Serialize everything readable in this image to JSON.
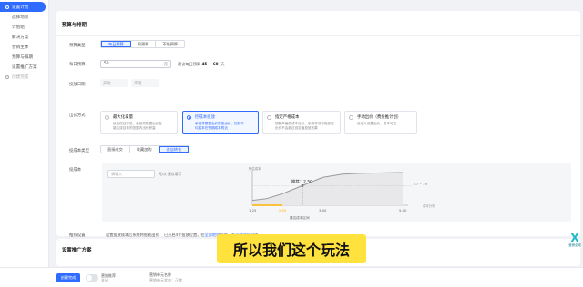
{
  "sidebar": {
    "items": [
      {
        "label": "设置计划",
        "state": "active"
      },
      {
        "label": "选择场景",
        "state": "normal"
      },
      {
        "label": "计划组",
        "state": "normal"
      },
      {
        "label": "解决方案",
        "state": "normal"
      },
      {
        "label": "营销主体",
        "state": "normal"
      },
      {
        "label": "预算与排期",
        "state": "normal"
      },
      {
        "label": "设置推广方案",
        "state": "normal"
      },
      {
        "label": "创建完成",
        "state": "muted"
      }
    ]
  },
  "budget_section": {
    "title": "预算与排期",
    "budget_type": {
      "label": "预算类型",
      "options": [
        "每日预算",
        "周预算",
        "不限预算"
      ],
      "selected": "每日预算"
    },
    "daily_budget": {
      "label": "每日预算",
      "value": "50",
      "unit": "元",
      "hint_prefix": "建议每日预算",
      "hint_range": "45 ~ 60",
      "hint_suffix": "/天"
    },
    "delivery_date": {
      "label": "投放日期",
      "start_placeholder": "开始",
      "end_placeholder": "不限"
    },
    "bid_method": {
      "label": "出价方式",
      "options": [
        {
          "title": "最大化拿量",
          "desc": [
            "优先保证拿量，系统将根据出价在",
            "能达成目标的范围内出价获量"
          ],
          "selected": false
        },
        {
          "title": "控成本投放",
          "desc": [
            "系统将根据出价智能出价，控制平",
            "均成本在预期成本附近"
          ],
          "selected": true
        },
        {
          "title": "指定严格成本",
          "desc": [
            "按照严格的成本目标，系统将尽可能保证",
            "出价不会超过设定值投放效果"
          ],
          "selected": false
        },
        {
          "title": "手动出价（费投推计划）",
          "desc": [
            "自定义设置出价，成本可控",
            ""
          ],
          "selected": false
        }
      ]
    },
    "target_cost_type": {
      "label": "投成本类型",
      "options": [
        "直接成交",
        "收藏加购",
        "进店转化"
      ],
      "selected": "进店转化"
    },
    "target_cost": {
      "label": "投成本",
      "input_placeholder": "请输入",
      "hint": "元/次 建议填写",
      "chart_data": {
        "type": "line",
        "title": "",
        "ylabel": "预估成本",
        "xlabel": "建议成本区间",
        "x_ticks": [
          "1.25",
          "2.00",
          "3.00",
          "5.00"
        ],
        "x": [
          1.25,
          1.6,
          2.0,
          2.5,
          3.0,
          3.5,
          4.0,
          5.0
        ],
        "values": [
          0.15,
          0.2,
          0.35,
          0.6,
          0.85,
          0.95,
          0.98,
          1.0
        ],
        "marker": {
          "label": "推荐：2.50",
          "x": 2.5
        },
        "right_label": "15 ~ 28",
        "right_axis_label": "成本分布",
        "highlight_range": [
          1.25,
          2.0
        ],
        "highlight_color": "#ffb400",
        "line_color": "#9a9a9a"
      }
    },
    "note": {
      "label": "推荐设置",
      "box_text": "设置投放成本后系统将智能出价",
      "text_prefix": "已开启",
      "count": "4",
      "text_middle": "个投放位置，在",
      "link1": "全部地域",
      "text_middle2": "投放，在",
      "link2": "全部时段",
      "text_suffix": "投放"
    }
  },
  "plan_section": {
    "title": "设置推广方案"
  },
  "footer": {
    "create_label": "创建完成",
    "toggle_label": "营销推荐",
    "toggle_sub": "关闭",
    "info_line1": "营销单元名称",
    "info_line2": "营销单元状态：正常"
  },
  "overlay": {
    "subtitle": "所以我们这个玩法"
  },
  "float_widget": {
    "logo": "X",
    "text": "营销全域"
  },
  "colors": {
    "accent": "#2f6bff",
    "subtitle_bg": "#ffe23d",
    "highlight": "#ffb400"
  }
}
